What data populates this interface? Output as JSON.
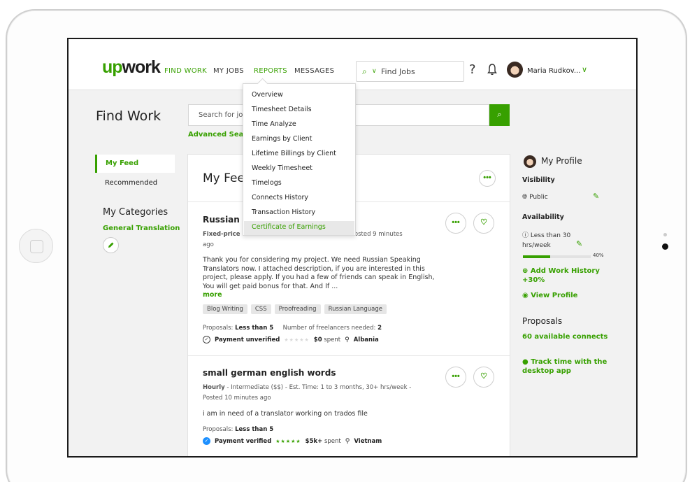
{
  "header": {
    "logo": "upwork",
    "nav": [
      "FIND WORK",
      "MY JOBS",
      "REPORTS",
      "MESSAGES"
    ],
    "search_placeholder": "Find Jobs",
    "help": "?",
    "user_name": "Maria Rudkov...",
    "icons": [
      "search-icon",
      "chevron-down-icon",
      "help-icon",
      "bell-icon",
      "avatar"
    ]
  },
  "page": {
    "title": "Find Work",
    "search_placeholder": "Search for jobs",
    "advanced_search": "Advanced Search"
  },
  "left_sidebar": {
    "my_feed": "My Feed",
    "recommended": "Recommended",
    "categories_title": "My Categories",
    "category": "General Translation"
  },
  "reports_menu": {
    "items": [
      "Overview",
      "Timesheet Details",
      "Time Analyze",
      "Earnings by Client",
      "Lifetime Billings by Client",
      "Weekly Timesheet",
      "Timelogs",
      "Connects History",
      "Transaction History",
      "Certificate of Earnings"
    ],
    "active": "Certificate of Earnings"
  },
  "feed": {
    "title": "My Feed",
    "jobs": [
      {
        "title": "Russian Sp",
        "meta_type": "Fixed-price",
        "meta_rest": "- Posted 9 minutes",
        "meta_line2": "ago",
        "description": "Thank you for considering my project. We need Russian Speaking Translators now. I attached description, if you are interested in this project, please apply. If you had a few of friends can speak in English, You will get paid bonus for that. And If ...",
        "more": "more",
        "tags": [
          "Blog Writing",
          "CSS",
          "Proofreading",
          "Russian Language"
        ],
        "proposals_label": "Proposals:",
        "proposals_value": "Less than 5",
        "freelancers_label": "Number of freelancers needed:",
        "freelancers_value": "2",
        "payment": "Payment unverified",
        "spent_value": "$0",
        "spent_label": "spent",
        "country": "Albania"
      },
      {
        "title": "small german english words",
        "meta_type": "Hourly",
        "meta_rest": "- Intermediate ($$) - Est. Time: 1 to 3 months, 30+ hrs/week -",
        "meta_line2": "Posted 10 minutes ago",
        "description": "i am in need of a translator working on trados file",
        "proposals_label": "Proposals:",
        "proposals_value": "Less than 5",
        "payment": "Payment verified",
        "spent_value": "$5k+",
        "spent_label": "spent",
        "country": "Vietnam"
      }
    ]
  },
  "right_sidebar": {
    "profile": "My Profile",
    "visibility_label": "Visibility",
    "visibility_value": "Public",
    "availability_label": "Availability",
    "availability_value": "Less than 30 hrs/week",
    "profile_completeness": 40,
    "profile_completeness_label": "40%",
    "add_work": "Add Work History +30%",
    "view_profile": "View Profile",
    "proposals_title": "Proposals",
    "connects": "60 available connects",
    "track_time": "Track time with the desktop app"
  },
  "colors": {
    "accent": "#37a000",
    "verified": "#1e90ff"
  }
}
